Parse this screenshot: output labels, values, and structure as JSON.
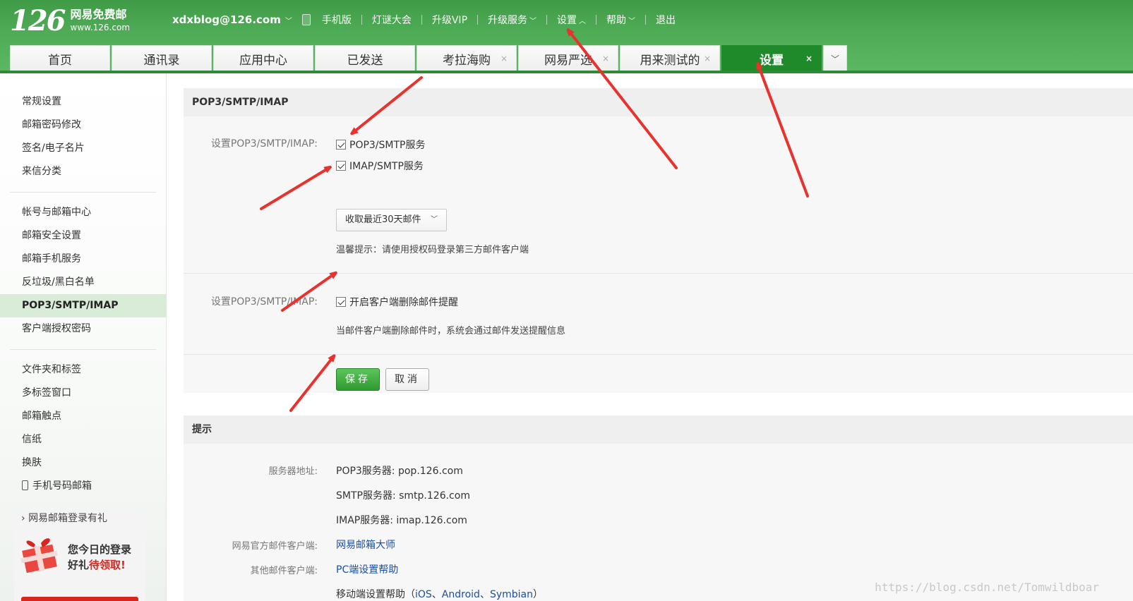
{
  "header": {
    "logo_number": "126",
    "logo_name": "网易免费邮",
    "logo_url": "www.126.com",
    "account": "xdxblog@126.com",
    "links": [
      {
        "label": "手机版",
        "arrow": ""
      },
      {
        "label": "灯谜大会",
        "arrow": ""
      },
      {
        "label": "升级VIP",
        "arrow": ""
      },
      {
        "label": "升级服务",
        "arrow": "﹀"
      },
      {
        "label": "设置",
        "arrow": "︿"
      },
      {
        "label": "帮助",
        "arrow": "﹀"
      },
      {
        "label": "退出",
        "arrow": ""
      }
    ]
  },
  "tabs": [
    {
      "label": "首页"
    },
    {
      "label": "通讯录"
    },
    {
      "label": "应用中心"
    },
    {
      "label": "已发送"
    },
    {
      "label": "考拉海购",
      "close": "×"
    },
    {
      "label": "网易严选",
      "close": "×"
    },
    {
      "label": "用来测试的",
      "close": "×"
    },
    {
      "label": "设置",
      "close": "×"
    }
  ],
  "sidebar": {
    "group1": [
      "常规设置",
      "邮箱密码修改",
      "签名/电子名片",
      "来信分类"
    ],
    "group2": [
      "帐号与邮箱中心",
      "邮箱安全设置",
      "邮箱手机服务",
      "反垃圾/黑白名单",
      "POP3/SMTP/IMAP",
      "客户端授权密码"
    ],
    "group3": [
      "文件夹和标签",
      "多标签窗口",
      "邮箱触点",
      "信纸",
      "换肤",
      "手机号码邮箱"
    ],
    "promo": {
      "title": "网易邮箱登录有礼",
      "line1": "您今日的登录",
      "line2a": "好礼",
      "line2b": "待领取!"
    }
  },
  "settings": {
    "section_title": "POP3/SMTP/IMAP",
    "label1": "设置POP3/SMTP/IMAP:",
    "opt_pop3": "POP3/SMTP服务",
    "opt_imap": "IMAP/SMTP服务",
    "select_value": "收取最近30天邮件",
    "hint1": "温馨提示：请使用授权码登录第三方邮件客户端",
    "label2": "设置POP3/SMTP/IMAP:",
    "opt_delete": "开启客户端删除邮件提醒",
    "hint2": "当邮件客户端删除邮件时，系统会通过邮件发送提醒信息",
    "save": "保存",
    "cancel": "取消"
  },
  "tips": {
    "section_title": "提示",
    "server_label": "服务器地址:",
    "pop3": "POP3服务器: pop.126.com",
    "smtp": "SMTP服务器: smtp.126.com",
    "imap": "IMAP服务器: imap.126.com",
    "official_label": "网易官方邮件客户端:",
    "official_link": "网易邮箱大师",
    "other_label": "其他邮件客户端:",
    "other_link": "PC端设置帮助",
    "mobile_prefix": "移动端设置帮助（",
    "mobile_ios": "iOS",
    "mobile_sep1": "、",
    "mobile_android": "Android",
    "mobile_sep2": "、",
    "mobile_symbian": "Symbian",
    "mobile_suffix": "）"
  },
  "watermark": "https://blog.csdn.net/Tomwildboar",
  "colors": {
    "header_green": "#4eab55",
    "active_tab": "#1f8a2a",
    "annotation_red": "#e8322e",
    "link_blue": "#1a4fa8"
  }
}
